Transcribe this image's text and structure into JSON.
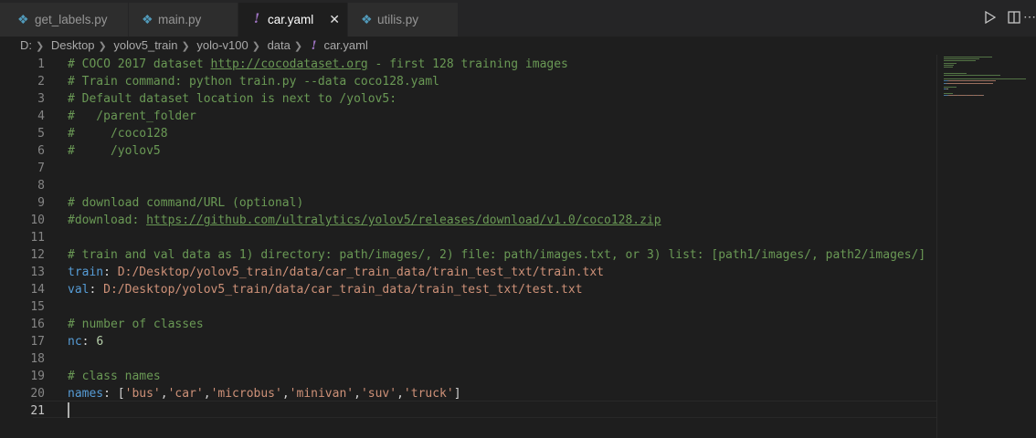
{
  "tabs": [
    {
      "label": "get_labels.py",
      "icon": "python-icon"
    },
    {
      "label": "main.py",
      "icon": "python-icon"
    },
    {
      "label": "car.yaml",
      "icon": "yaml-icon",
      "active": true
    },
    {
      "label": "utilis.py",
      "icon": "python-icon"
    }
  ],
  "breadcrumb": [
    "D:",
    "Desktop",
    "yolov5_train",
    "yolo-v100",
    "data",
    "car.yaml"
  ],
  "editor": {
    "current_line": 21,
    "lines": [
      {
        "n": "1",
        "tokens": [
          {
            "t": "c",
            "v": "# COCO 2017 dataset "
          },
          {
            "t": "u",
            "v": "http://cocodataset.org"
          },
          {
            "t": "c",
            "v": " - first 128 training images"
          }
        ]
      },
      {
        "n": "2",
        "tokens": [
          {
            "t": "c",
            "v": "# Train command: python train.py --data coco128.yaml"
          }
        ]
      },
      {
        "n": "3",
        "tokens": [
          {
            "t": "c",
            "v": "# Default dataset location is next to /yolov5:"
          }
        ]
      },
      {
        "n": "4",
        "tokens": [
          {
            "t": "c",
            "v": "#   /parent_folder"
          }
        ]
      },
      {
        "n": "5",
        "tokens": [
          {
            "t": "c",
            "v": "#     /coco128"
          }
        ]
      },
      {
        "n": "6",
        "tokens": [
          {
            "t": "c",
            "v": "#     /yolov5"
          }
        ]
      },
      {
        "n": "7",
        "tokens": []
      },
      {
        "n": "8",
        "tokens": []
      },
      {
        "n": "9",
        "tokens": [
          {
            "t": "c",
            "v": "# download command/URL (optional)"
          }
        ]
      },
      {
        "n": "10",
        "tokens": [
          {
            "t": "c",
            "v": "#download: "
          },
          {
            "t": "u",
            "v": "https://github.com/ultralytics/yolov5/releases/download/v1.0/coco128.zip"
          }
        ]
      },
      {
        "n": "11",
        "tokens": []
      },
      {
        "n": "12",
        "tokens": [
          {
            "t": "c",
            "v": "# train and val data as 1) directory: path/images/, 2) file: path/images.txt, or 3) list: [path1/images/, path2/images/]"
          }
        ]
      },
      {
        "n": "13",
        "tokens": [
          {
            "t": "k",
            "v": "train"
          },
          {
            "t": "p",
            "v": ": "
          },
          {
            "t": "s",
            "v": "D:/Desktop/yolov5_train/data/car_train_data/train_test_txt/train.txt"
          }
        ]
      },
      {
        "n": "14",
        "tokens": [
          {
            "t": "k",
            "v": "val"
          },
          {
            "t": "p",
            "v": ": "
          },
          {
            "t": "s",
            "v": "D:/Desktop/yolov5_train/data/car_train_data/train_test_txt/test.txt"
          }
        ]
      },
      {
        "n": "15",
        "tokens": []
      },
      {
        "n": "16",
        "tokens": [
          {
            "t": "c",
            "v": "# number of classes"
          }
        ]
      },
      {
        "n": "17",
        "tokens": [
          {
            "t": "k",
            "v": "nc"
          },
          {
            "t": "p",
            "v": ": "
          },
          {
            "t": "n",
            "v": "6"
          }
        ]
      },
      {
        "n": "18",
        "tokens": []
      },
      {
        "n": "19",
        "tokens": [
          {
            "t": "c",
            "v": "# class names"
          }
        ]
      },
      {
        "n": "20",
        "tokens": [
          {
            "t": "k",
            "v": "names"
          },
          {
            "t": "p",
            "v": ": ["
          },
          {
            "t": "s",
            "v": "'bus'"
          },
          {
            "t": "p",
            "v": ","
          },
          {
            "t": "s",
            "v": "'car'"
          },
          {
            "t": "p",
            "v": ","
          },
          {
            "t": "s",
            "v": "'microbus'"
          },
          {
            "t": "p",
            "v": ","
          },
          {
            "t": "s",
            "v": "'minivan'"
          },
          {
            "t": "p",
            "v": ","
          },
          {
            "t": "s",
            "v": "'suv'"
          },
          {
            "t": "p",
            "v": ","
          },
          {
            "t": "s",
            "v": "'truck'"
          },
          {
            "t": "p",
            "v": "]"
          }
        ]
      },
      {
        "n": "21",
        "tokens": []
      }
    ]
  },
  "colors": {
    "comment": "#6a9955",
    "key": "#569cd6",
    "string": "#ce9178",
    "number": "#b5cea8",
    "background": "#1e1e1e"
  }
}
